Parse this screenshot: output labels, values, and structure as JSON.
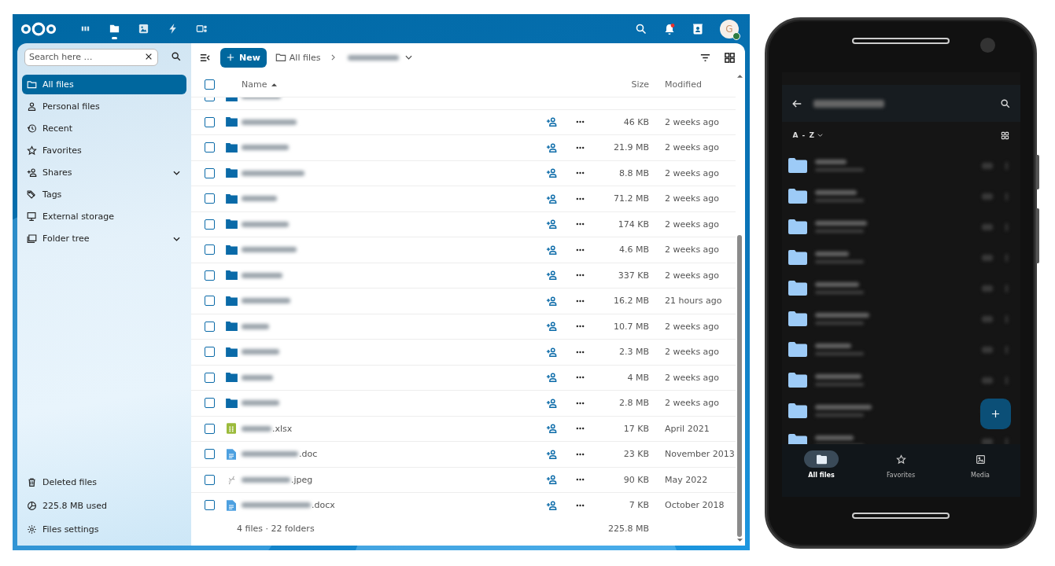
{
  "top_bar": {
    "apps": [
      {
        "kind": "dashboard",
        "selected": false
      },
      {
        "kind": "files",
        "selected": true
      },
      {
        "kind": "photos",
        "selected": false
      },
      {
        "kind": "activity",
        "selected": false
      },
      {
        "kind": "deck",
        "selected": false
      }
    ],
    "notifications_unread": true,
    "avatar": {
      "initial": "G",
      "online": true
    }
  },
  "sidebar": {
    "search": {
      "placeholder": "Search here …"
    },
    "items": [
      {
        "label": "All files",
        "kind": "folder",
        "selected": true,
        "expandable": false
      },
      {
        "label": "Personal files",
        "kind": "person",
        "selected": false,
        "expandable": false
      },
      {
        "label": "Recent",
        "kind": "history",
        "selected": false,
        "expandable": false
      },
      {
        "label": "Favorites",
        "kind": "star",
        "selected": false,
        "expandable": false
      },
      {
        "label": "Shares",
        "kind": "share",
        "selected": false,
        "expandable": true
      },
      {
        "label": "Tags",
        "kind": "tag",
        "selected": false,
        "expandable": false
      },
      {
        "label": "External storage",
        "kind": "monitor",
        "selected": false,
        "expandable": false
      },
      {
        "label": "Folder tree",
        "kind": "folders",
        "selected": false,
        "expandable": true
      }
    ],
    "footer": [
      {
        "label": "Deleted files",
        "kind": "trash"
      },
      {
        "label": "225.8 MB used",
        "kind": "pie"
      },
      {
        "label": "Files settings",
        "kind": "gear"
      }
    ]
  },
  "toolbar": {
    "new_button": "New",
    "breadcrumb": "All files"
  },
  "table": {
    "columns": [
      "Name",
      "Size",
      "Modified"
    ],
    "sorted_ascending": true,
    "all_checked": false,
    "partial_row": {
      "checked": false
    },
    "rows": [
      {
        "kind": "folder",
        "checked": false,
        "size": "46 KB",
        "modified": "2 weeks ago"
      },
      {
        "kind": "folder",
        "checked": false,
        "size": "21.9 MB",
        "modified": "2 weeks ago"
      },
      {
        "kind": "folder",
        "checked": false,
        "size": "8.8 MB",
        "modified": "2 weeks ago"
      },
      {
        "kind": "folder",
        "checked": false,
        "size": "71.2 MB",
        "modified": "2 weeks ago"
      },
      {
        "kind": "folder",
        "checked": false,
        "size": "174 KB",
        "modified": "2 weeks ago"
      },
      {
        "kind": "folder",
        "checked": false,
        "size": "4.6 MB",
        "modified": "2 weeks ago"
      },
      {
        "kind": "folder",
        "checked": false,
        "size": "337 KB",
        "modified": "2 weeks ago"
      },
      {
        "kind": "folder",
        "checked": false,
        "size": "16.2 MB",
        "modified": "21 hours ago"
      },
      {
        "kind": "folder",
        "checked": false,
        "size": "10.7 MB",
        "modified": "2 weeks ago"
      },
      {
        "kind": "folder",
        "checked": false,
        "size": "2.3 MB",
        "modified": "2 weeks ago"
      },
      {
        "kind": "folder",
        "checked": false,
        "size": "4 MB",
        "modified": "2 weeks ago"
      },
      {
        "kind": "folder",
        "checked": false,
        "size": "2.8 MB",
        "modified": "2 weeks ago"
      },
      {
        "kind": "spreadsheet",
        "checked": false,
        "extension": ".xlsx",
        "size": "17 KB",
        "modified": "April 2021"
      },
      {
        "kind": "document",
        "checked": false,
        "extension": ".doc",
        "size": "23 KB",
        "modified": "November 2013"
      },
      {
        "kind": "image",
        "checked": false,
        "extension": ".jpeg",
        "size": "90 KB",
        "modified": "May 2022"
      },
      {
        "kind": "document",
        "checked": false,
        "extension": ".docx",
        "size": "7 KB",
        "modified": "October 2018"
      }
    ],
    "summary": "4 files · 22 folders",
    "total": "225.8 MB"
  },
  "phone": {
    "sort": "A - Z",
    "nav": [
      {
        "label": "All files",
        "kind": "folder",
        "selected": true
      },
      {
        "label": "Favorites",
        "kind": "star",
        "selected": false
      },
      {
        "label": "Media",
        "kind": "image",
        "selected": false
      }
    ]
  }
}
